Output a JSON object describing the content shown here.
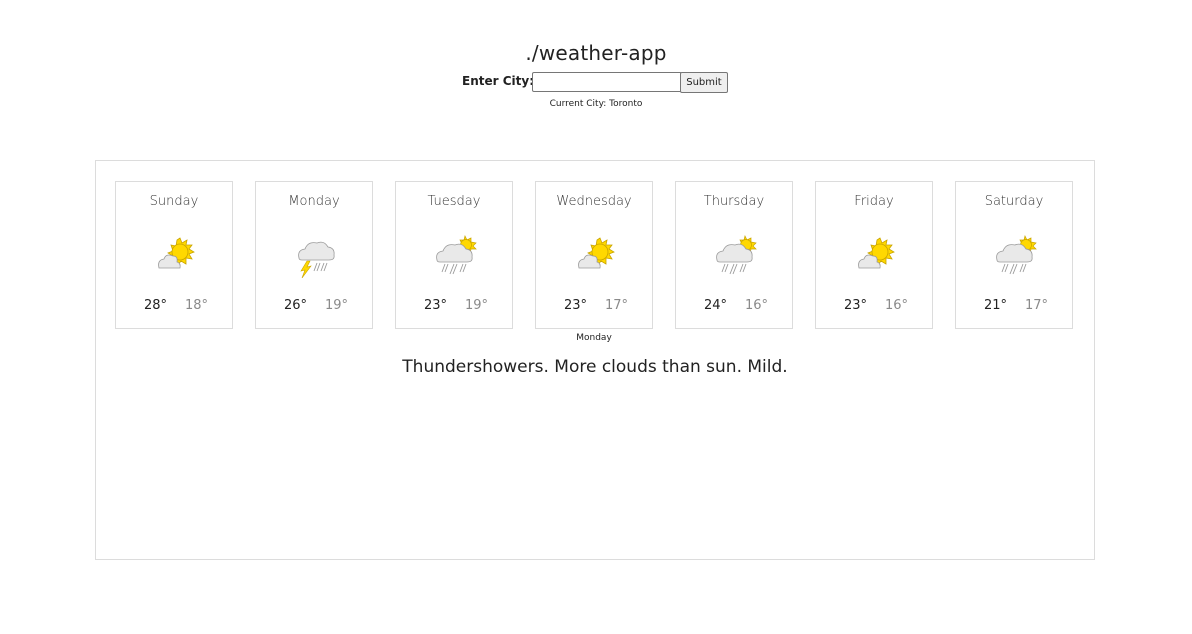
{
  "header": {
    "title": "./weather-app"
  },
  "form": {
    "label": "Enter City:",
    "input_value": "",
    "submit_label": "Submit",
    "current_city": "Current City: Toronto"
  },
  "forecast": {
    "days": [
      {
        "name": "Sunday",
        "high": "28°",
        "low": "18°",
        "icon": "sun-behind-cloud-icon"
      },
      {
        "name": "Monday",
        "high": "26°",
        "low": "19°",
        "icon": "thunder-rain-cloud-icon"
      },
      {
        "name": "Tuesday",
        "high": "23°",
        "low": "19°",
        "icon": "sun-cloud-rain-icon"
      },
      {
        "name": "Wednesday",
        "high": "23°",
        "low": "17°",
        "icon": "sun-behind-cloud-icon"
      },
      {
        "name": "Thursday",
        "high": "24°",
        "low": "16°",
        "icon": "sun-cloud-rain-icon"
      },
      {
        "name": "Friday",
        "high": "23°",
        "low": "16°",
        "icon": "sun-behind-cloud-icon"
      },
      {
        "name": "Saturday",
        "high": "21°",
        "low": "17°",
        "icon": "sun-cloud-rain-icon"
      }
    ],
    "selected_day": "Monday",
    "description": "Thundershowers. More clouds than sun. Mild."
  },
  "colors": {
    "sun": "#ffd800",
    "sun_outline": "#c9a400",
    "cloud": "#e9e9e9",
    "cloud_outline": "#9a9a9a",
    "border": "#dcdcdc"
  }
}
